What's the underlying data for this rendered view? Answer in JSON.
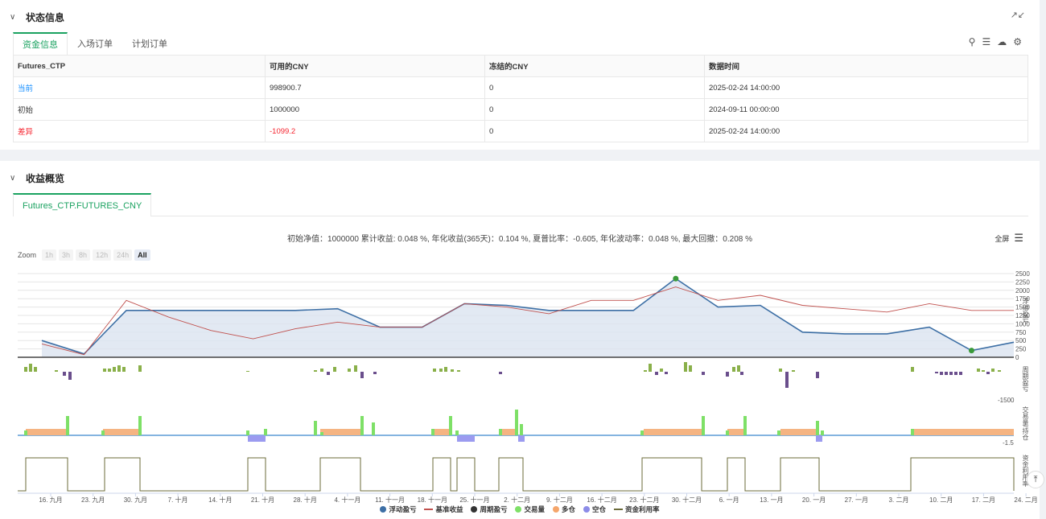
{
  "status": {
    "title": "状态信息",
    "tabs": [
      "资金信息",
      "入场订单",
      "计划订单"
    ],
    "table": {
      "headers": [
        "Futures_CTP",
        "可用的CNY",
        "冻结的CNY",
        "数据时间"
      ],
      "rows": [
        [
          "当前",
          "998900.7",
          "0",
          "2025-02-24 14:00:00"
        ],
        [
          "初始",
          "1000000",
          "0",
          "2024-09-11 00:00:00"
        ],
        [
          "差异",
          "-1099.2",
          "0",
          "2025-02-24 14:00:00"
        ]
      ]
    }
  },
  "overview": {
    "title": "收益概览",
    "tab": "Futures_CTP.FUTURES_CNY",
    "summary": "初始净值：1000000 累计收益: 0.048 %, 年化收益(365天)：0.104 %, 夏普比率：-0.605, 年化波动率：0.048 %, 最大回撤：0.208 %",
    "fullscreen": "全屏",
    "zoom_label": "Zoom",
    "zoom_options": [
      "1h",
      "3h",
      "8h",
      "12h",
      "24h",
      "All"
    ],
    "zoom_selected": "All",
    "axis_labels": {
      "pnl": "浮动盈亏",
      "period": "周期盈亏",
      "volume": "交易量/持仓",
      "util": "资金利用率"
    },
    "y_ticks_main": [
      "2500",
      "2250",
      "2000",
      "1750",
      "1500",
      "1250",
      "1000",
      "750",
      "500",
      "250",
      "0"
    ],
    "y_tick_period": "-1500",
    "y_tick_volume": "-1.5",
    "legend": [
      {
        "label": "浮动盈亏",
        "color": "#3d6fa5",
        "shape": "dot"
      },
      {
        "label": "基准收益",
        "color": "#c0504d",
        "shape": "line"
      },
      {
        "label": "周期盈亏",
        "color": "#333333",
        "shape": "dot"
      },
      {
        "label": "交易量",
        "color": "#7ee067",
        "shape": "dot"
      },
      {
        "label": "多仓",
        "color": "#f5a66b",
        "shape": "dot"
      },
      {
        "label": "空仓",
        "color": "#8c8ce8",
        "shape": "dot"
      },
      {
        "label": "资金利用率",
        "color": "#6b6b3a",
        "shape": "line"
      }
    ]
  },
  "chart_data": {
    "type": "line",
    "x": [
      "16. 九月",
      "23. 九月",
      "30. 九月",
      "7. 十月",
      "14. 十月",
      "21. 十月",
      "28. 十月",
      "4. 十一月",
      "11. 十一月",
      "18. 十一月",
      "25. 十一月",
      "2. 十二月",
      "9. 十二月",
      "16. 十二月",
      "23. 十二月",
      "30. 十二月",
      "6. 一月",
      "13. 一月",
      "20. 一月",
      "27. 一月",
      "3. 二月",
      "10. 二月",
      "17. 二月",
      "24. 二月"
    ],
    "series": [
      {
        "name": "浮动盈亏",
        "values": [
          500,
          100,
          1400,
          1400,
          1400,
          1400,
          1400,
          1450,
          900,
          900,
          1600,
          1550,
          1400,
          1400,
          1400,
          2350,
          1500,
          1550,
          750,
          700,
          700,
          900,
          200,
          450
        ]
      },
      {
        "name": "基准收益",
        "values": [
          400,
          80,
          1700,
          1200,
          800,
          550,
          850,
          1050,
          900,
          900,
          1600,
          1500,
          1300,
          1700,
          1700,
          2100,
          1700,
          1850,
          1550,
          1450,
          1350,
          1600,
          1400,
          1400
        ]
      }
    ],
    "ylim": [
      0,
      2500
    ]
  },
  "icons": {
    "collapse": "chevron-down-icon",
    "expand": "expand-icon",
    "search": "search-icon",
    "list": "list-icon",
    "download": "cloud-download-icon",
    "settings": "gear-icon",
    "menu": "menu-icon",
    "back_to_top": "back-to-top-icon"
  }
}
